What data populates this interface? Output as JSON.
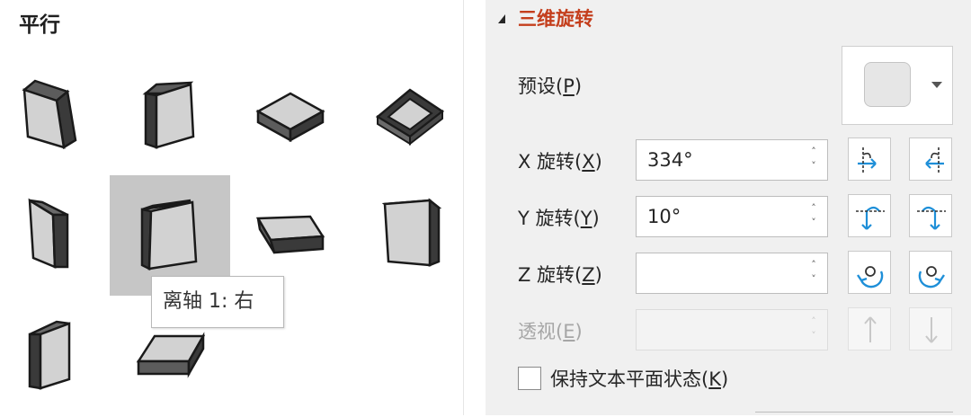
{
  "gallery": {
    "title": "平行",
    "tooltip": "离轴 1: 右",
    "items": [
      {
        "name": "preset-shape-1",
        "selected": false
      },
      {
        "name": "preset-shape-2",
        "selected": false
      },
      {
        "name": "preset-shape-3",
        "selected": false
      },
      {
        "name": "preset-shape-4",
        "selected": false
      },
      {
        "name": "preset-shape-5",
        "selected": false
      },
      {
        "name": "preset-shape-6",
        "selected": true
      },
      {
        "name": "preset-shape-7",
        "selected": false
      },
      {
        "name": "preset-shape-8",
        "selected": false
      },
      {
        "name": "preset-shape-9",
        "selected": false
      },
      {
        "name": "preset-shape-10",
        "selected": false
      }
    ]
  },
  "pane": {
    "section_title": "三维旋转",
    "preset": {
      "label": "预设(",
      "key": "P",
      "suffix": ")"
    },
    "x_rotation": {
      "label": "X 旋转(",
      "key": "X",
      "suffix": ")",
      "value": "334°"
    },
    "y_rotation": {
      "label": "Y 旋转(",
      "key": "Y",
      "suffix": ")",
      "value": "10°"
    },
    "z_rotation": {
      "label": "Z 旋转(",
      "key": "Z",
      "suffix": ")",
      "value": ""
    },
    "perspective": {
      "label": "透视(",
      "key": "E",
      "suffix": ")",
      "value": "",
      "disabled": true
    },
    "keep_text_flat": {
      "label": "保持文本平面状态(",
      "key": "K",
      "suffix": ")",
      "checked": false
    },
    "spin_up": "˄",
    "spin_down": "˅",
    "icons": {
      "x_left": "rotate-left-icon",
      "x_right": "rotate-right-icon",
      "y_up": "rotate-up-icon",
      "y_down": "rotate-down-icon",
      "z_ccw": "rotate-counterclockwise-icon",
      "z_cw": "rotate-clockwise-icon",
      "persp_up": "increase-perspective-icon",
      "persp_down": "decrease-perspective-icon"
    },
    "colors": {
      "accent": "#c43e1c",
      "icon_blue": "#1e8fd8"
    }
  }
}
